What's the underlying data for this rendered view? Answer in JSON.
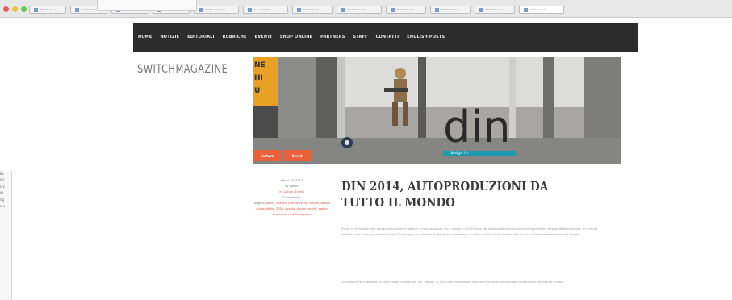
{
  "browser": {
    "tabs": [
      {
        "label": "Mozilla Scuola"
      },
      {
        "label": "Mozilla Scuola"
      },
      {
        "label": "Mozilla Scuola"
      },
      {
        "label": "Mozilla Scuola"
      },
      {
        "label": "Switch magazine"
      },
      {
        "label": "Re - Carrefour"
      },
      {
        "label": "Booking.com"
      },
      {
        "label": "Mozilla Scuola"
      },
      {
        "label": "Mozilla Scuola"
      },
      {
        "label": "Mozilla Scuola"
      },
      {
        "label": "Mozilla Scuola"
      },
      {
        "label": "Il Manuale di..."
      }
    ]
  },
  "nav": {
    "items": [
      "HOME",
      "NOTIZIE",
      "EDITORIALI",
      "RUBRICHE",
      "EVENTI",
      "SHOP ONLINE",
      "PARTNERS",
      "STAFF",
      "CONTATTI",
      "ENGLISH POSTS"
    ]
  },
  "site": {
    "logo": "SWITCHMAGAZINE"
  },
  "hero": {
    "brand_text": "din",
    "brand_subtext": "design in",
    "banner_letters": [
      "NE",
      "HI",
      "U"
    ],
    "chips": [
      "Cultura",
      "Eventi"
    ]
  },
  "article": {
    "title": "DIN 2014, AUTOPRODUZIONI DA TUTTO IL MONDO",
    "meta": {
      "date": "Marzo 18, 2014",
      "by": "by admin",
      "comments": "in Cultura, Eventi",
      "comments_count": "0 Comments",
      "tags_label": "Tagged",
      "tags": "cultura, cultura, cultura eventi, design, design autoprodotto, 2014, evento, design, eventi, switch magazine, switchmagazine"
    },
    "paragraphs": [
      "Punto di riferimento del design indipendente italiano e internazionale, din - design in 2014 torna per la seconda edizione durante la prossima Design Week milanese. Un evento dedicato alle autoproduzioni da oltre 100 designer e numerosi studenti che animeranno l'ultimo edificio della zona ex officina con l'alzata internazionale del design.",
      "Un'edizione all'interno di un polo design industriale. din - design in 2014 che ha ospitato moltissimi designer autoprodotti e tantissimi visitatori e curiosi."
    ]
  },
  "sidebar": {
    "lines": [
      "BL",
      "Ed",
      "OV",
      "W",
      "",
      "ng",
      "x-s"
    ]
  },
  "colors": {
    "navbar": "#2c2c2c",
    "accent": "#e9603a",
    "din_teal": "#1b9bb0"
  }
}
